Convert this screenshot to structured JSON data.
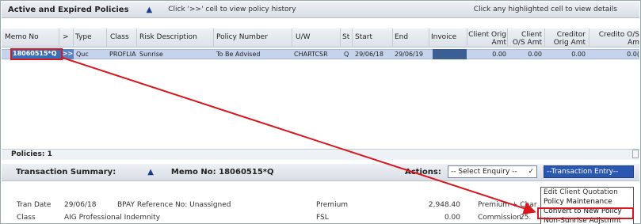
{
  "policies_panel": {
    "title": "Active and Expired Policies",
    "hint_left": "Click '>>' cell to view policy history",
    "hint_right": "Click any highlighted cell to view details",
    "columns": {
      "memo_no": "Memo No",
      "hist": ">",
      "type": "Type",
      "class": "Class",
      "risk": "Risk Description",
      "policy_number": "Policy Number",
      "uw": "U/W",
      "st": "St",
      "start": "Start",
      "end": "End",
      "invoice": "Invoice",
      "client_orig_amt": "Client Orig Amt",
      "client_os_amt": "Client O/S Amt",
      "creditor_orig_amt": "Creditor Orig Amt",
      "creditor_os_amt": "Credito O/S Am"
    },
    "row": {
      "memo_no": "18060515*Q",
      "hist": ">>",
      "type": "Quc",
      "class": "PROFLIA",
      "risk": "Sunrise",
      "policy_number": "To Be Advised",
      "uw": "CHARTCSR",
      "st": "Q",
      "start": "29/06/18",
      "end": "29/06/19",
      "client_orig_amt": "0.00",
      "client_os_amt": "0.00",
      "creditor_orig_amt": "0.00",
      "creditor_os_amt": "0.0("
    },
    "count_label": "Policies: 1"
  },
  "transaction_summary": {
    "title": "Transaction Summary:",
    "memo_label": "Memo No: 18060515*Q",
    "actions_label": "Actions:",
    "enquiry_select": "-- Select Enquiry --",
    "transaction_select": "--Transaction Entry--",
    "dropdown_items": [
      "Edit Client Quotation",
      "Policy Maintenance",
      "Convert to New Policy",
      "Non-Sunrise Adjstmnt"
    ],
    "details": {
      "tran_date_label": "Tran Date",
      "tran_date_value": "29/06/18",
      "bpay_label": "BPAY Reference No: Unassigned",
      "class_label": "Class",
      "class_value": "AIG Professional Indemnity",
      "premium_label": "Premium",
      "premium_value": "2,948.40",
      "fsl_label": "FSL",
      "fsl_value": "0.00",
      "premium_charges_label": "Premium + Char",
      "commission_label": "Commission",
      "commission_value": "25."
    }
  },
  "colors": {
    "accent": "#2a57b0",
    "selected_row": "#c5d3ec",
    "annotation_red": "#d9161c"
  }
}
